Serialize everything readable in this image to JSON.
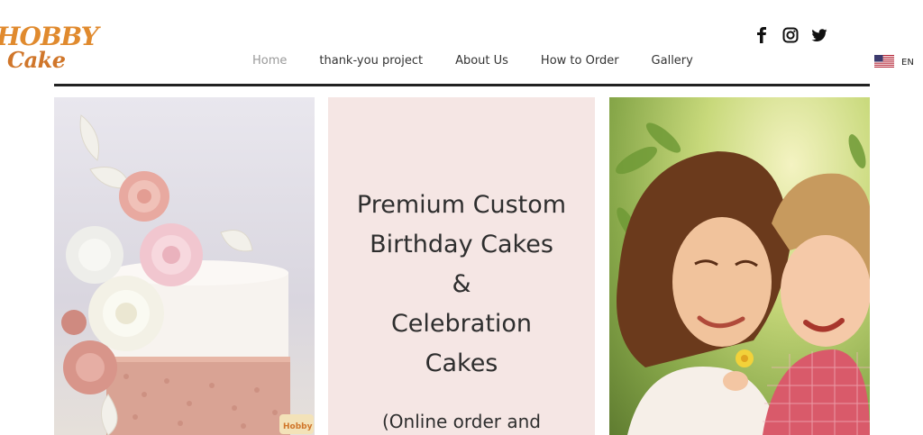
{
  "brand": {
    "logo_line1": "HOBBY",
    "logo_line2": "Cake",
    "logo_colors": [
      "#e08a2e",
      "#d0762a"
    ]
  },
  "nav": {
    "items": [
      {
        "label": "Home",
        "active": true
      },
      {
        "label": "thank-you project",
        "active": false
      },
      {
        "label": "About Us",
        "active": false
      },
      {
        "label": "How to Order",
        "active": false
      },
      {
        "label": "Gallery",
        "active": false
      }
    ]
  },
  "social": {
    "icons": [
      "facebook-icon",
      "instagram-icon",
      "twitter-icon"
    ]
  },
  "language": {
    "label": "EN",
    "flag": "us-flag-icon"
  },
  "hero": {
    "lines": [
      "Premium Custom",
      "Birthday Cakes",
      "&",
      "Celebration",
      "Cakes"
    ],
    "subtext": "(Online order and",
    "panel_color": "#f5e6e4"
  },
  "images": {
    "left": "cake-with-sugar-flowers-image",
    "right": "mother-and-daughter-image"
  }
}
